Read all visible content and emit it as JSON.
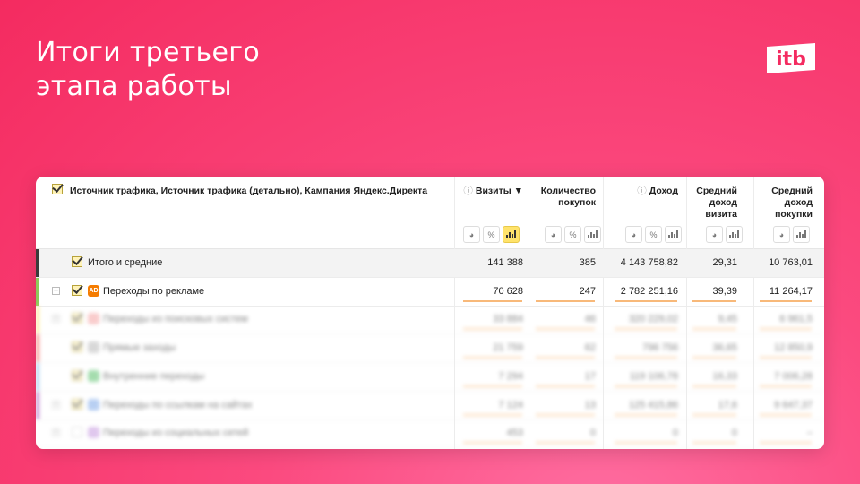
{
  "slide": {
    "title_line1": "Итоги третьего",
    "title_line2": "этапа работы",
    "logo_text": "itb"
  },
  "table": {
    "dimension_header": "Источник трафика, Источник трафика (детально), Кампания Яндекс.Директа",
    "columns": [
      {
        "key": "visits",
        "label_lines": [
          "Визиты ▼"
        ],
        "has_info_icon": true
      },
      {
        "key": "purchases",
        "label_lines": [
          "Количество",
          "покупок"
        ],
        "has_info_icon": false
      },
      {
        "key": "revenue",
        "label_lines": [
          "Доход"
        ],
        "has_info_icon": true
      },
      {
        "key": "avg_visit",
        "label_lines": [
          "Средний",
          "доход",
          "визита"
        ],
        "has_info_icon": false
      },
      {
        "key": "avg_purchase",
        "label_lines": [
          "Средний",
          "доход",
          "покупки"
        ],
        "has_info_icon": false
      }
    ],
    "icons": {
      "info": "info-circle-icon",
      "pie": "pie-chart-icon",
      "percent": "percent-icon",
      "bars": "bar-chart-icon",
      "ad": "ad-badge-icon",
      "expand": "plus-square-icon"
    },
    "rows": [
      {
        "label": "Итого и средние",
        "visits": "141 388",
        "purchases": "385",
        "revenue": "4 143 758,82",
        "avg_visit": "29,31",
        "avg_purchase": "10 763,01",
        "stripe": "#3a3a3a",
        "checked": true,
        "expandable": false,
        "icon": ""
      },
      {
        "label": "Переходы по рекламе",
        "visits": "70 628",
        "purchases": "247",
        "revenue": "2 782 251,16",
        "avg_visit": "39,39",
        "avg_purchase": "11 264,17",
        "stripe": "#8dc95b",
        "checked": true,
        "expandable": true,
        "icon": "AD",
        "icon_color": "#f57c00"
      },
      {
        "label": "Переходы из поисковых систем",
        "visits": "33 884",
        "purchases": "46",
        "revenue": "320 229,02",
        "avg_visit": "9,45",
        "avg_purchase": "6 961,5",
        "stripe": "#ffe066",
        "checked": true,
        "expandable": true,
        "icon": "",
        "icon_color": "#f5a3a3"
      },
      {
        "label": "Прямые заходы",
        "visits": "21 759",
        "purchases": "62",
        "revenue": "796 756",
        "avg_visit": "36,65",
        "avg_purchase": "12 850,9",
        "stripe": "#f05a4f",
        "checked": true,
        "expandable": false,
        "icon": "",
        "icon_color": "#b9b9b9"
      },
      {
        "label": "Внутренние переходы",
        "visits": "7 294",
        "purchases": "17",
        "revenue": "119 106,78",
        "avg_visit": "16,33",
        "avg_purchase": "7 006,28",
        "stripe": "#7fb5e6",
        "checked": true,
        "expandable": false,
        "icon": "",
        "icon_color": "#5ac06b"
      },
      {
        "label": "Переходы по ссылкам на сайтах",
        "visits": "7 124",
        "purchases": "13",
        "revenue": "125 415,86",
        "avg_visit": "17,6",
        "avg_purchase": "9 647,37",
        "stripe": "#a04bb5",
        "checked": true,
        "expandable": true,
        "icon": "",
        "icon_color": "#7fa9e8"
      },
      {
        "label": "Переходы из социальных сетей",
        "visits": "453",
        "purchases": "0",
        "revenue": "0",
        "avg_visit": "0",
        "avg_purchase": "–",
        "stripe": "#ffffff",
        "checked": false,
        "expandable": true,
        "icon": "",
        "icon_color": "#c79be0"
      }
    ]
  }
}
